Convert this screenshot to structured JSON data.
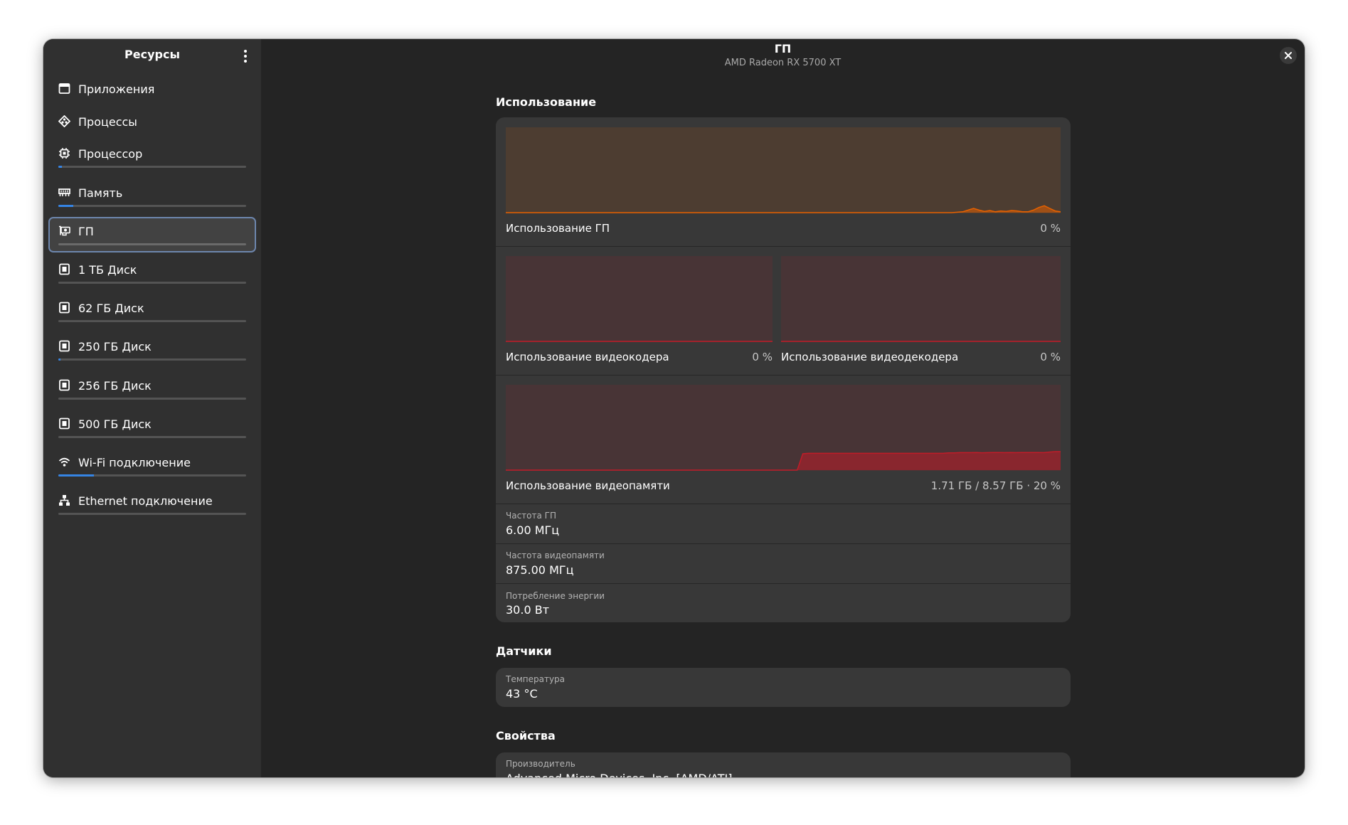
{
  "sidebar": {
    "title": "Ресурсы",
    "items": [
      {
        "label": "Приложения",
        "icon": "apps-icon"
      },
      {
        "label": "Процессы",
        "icon": "processes-icon"
      },
      {
        "label": "Процессор",
        "icon": "cpu-icon",
        "usage": 0.02
      },
      {
        "label": "Память",
        "icon": "memory-icon",
        "usage": 0.08
      },
      {
        "label": "ГП",
        "icon": "gpu-icon",
        "usage": 0.0,
        "active": true
      },
      {
        "label": "1 ТБ Диск",
        "icon": "disk-icon",
        "usage": 0.0
      },
      {
        "label": "62 ГБ Диск",
        "icon": "disk-icon",
        "usage": 0.0
      },
      {
        "label": "250 ГБ Диск",
        "icon": "disk-icon",
        "usage": 0.01
      },
      {
        "label": "256 ГБ Диск",
        "icon": "disk-icon",
        "usage": 0.0
      },
      {
        "label": "500 ГБ Диск",
        "icon": "disk-icon",
        "usage": 0.0
      },
      {
        "label": "Wi-Fi подключение",
        "icon": "wifi-icon",
        "usage": 0.19
      },
      {
        "label": "Ethernet подключение",
        "icon": "ethernet-icon",
        "usage": 0.0
      }
    ]
  },
  "header": {
    "title": "ГП",
    "subtitle": "AMD Radeon RX 5700 XT"
  },
  "usage": {
    "section_title": "Использование",
    "gpu": {
      "label": "Использование ГП",
      "value": "0 %",
      "color": "#e66100"
    },
    "encoder": {
      "label": "Использование видеокодера",
      "value": "0 %",
      "color": "#c01c28"
    },
    "decoder": {
      "label": "Использование видеодекодера",
      "value": "0 %",
      "color": "#c01c28"
    },
    "vram": {
      "label": "Использование видеопамяти",
      "value": "1.71 ГБ / 8.57 ГБ · 20 %",
      "color": "#c01c28"
    },
    "props": [
      {
        "title": "Частота ГП",
        "value": "6.00 МГц"
      },
      {
        "title": "Частота видеопамяти",
        "value": "875.00 МГц"
      },
      {
        "title": "Потребление энергии",
        "value": "30.0 Вт"
      }
    ]
  },
  "sensors": {
    "section_title": "Датчики",
    "temperature": {
      "title": "Температура",
      "value": "43 °C"
    }
  },
  "properties": {
    "section_title": "Свойства",
    "manufacturer": {
      "title": "Производитель",
      "value": "Advanced Micro Devices, Inc. [AMD/ATI]"
    }
  },
  "history": {
    "gpu": [
      0,
      0,
      0,
      0,
      0,
      0,
      0,
      0,
      0,
      0,
      0,
      0,
      0,
      0,
      0,
      0,
      0,
      0,
      0,
      0,
      0,
      0,
      0,
      0,
      0,
      0,
      0,
      0,
      0,
      0,
      0,
      0,
      0,
      0,
      0,
      0,
      0,
      0,
      0,
      0,
      0,
      0,
      0,
      0,
      0,
      0,
      0,
      0,
      0,
      0,
      0,
      0,
      0,
      0,
      0,
      0,
      0,
      0,
      0,
      0,
      0,
      0,
      0,
      0,
      0,
      0,
      0,
      0,
      0,
      0,
      0,
      0,
      0,
      0,
      0,
      0,
      0,
      0,
      0,
      0,
      0,
      0,
      0,
      0.5,
      1,
      3,
      5,
      3,
      1.5,
      2.5,
      1,
      2,
      1.5,
      2.5,
      2,
      1,
      1,
      3,
      6,
      8,
      5,
      2,
      1
    ],
    "encoder": [],
    "decoder": [],
    "vram": [
      0,
      0,
      0,
      0,
      0,
      0,
      0,
      0,
      0,
      0,
      0,
      0,
      0,
      0,
      0,
      0,
      0,
      0,
      0,
      0,
      0,
      0,
      0,
      0,
      0,
      0,
      0,
      0,
      0,
      0,
      0,
      0,
      0,
      0,
      0,
      0,
      0,
      0,
      0,
      0,
      0,
      0,
      0,
      0,
      0,
      0,
      0,
      0,
      0,
      0,
      0,
      0,
      0,
      19,
      19.5,
      19.5,
      19.5,
      19.5,
      19.5,
      19.5,
      19.5,
      19.5,
      19.5,
      19.5,
      19.5,
      19.5,
      19.5,
      19.5,
      19.5,
      19.5,
      19.5,
      19.5,
      19.5,
      19.5,
      19.5,
      19.5,
      19.5,
      19.5,
      19.5,
      20,
      20,
      20.3,
      20.3,
      20.3,
      20.5,
      20.2,
      20.3,
      20.5,
      20.5,
      20.3,
      20.5,
      20.3,
      20.5,
      20.5,
      20.5,
      20.5,
      20.3,
      21,
      21.5,
      21.5
    ]
  }
}
